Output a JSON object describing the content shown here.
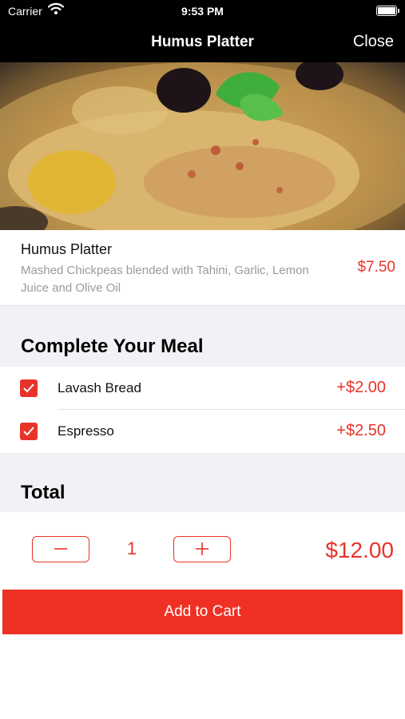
{
  "status_bar": {
    "carrier": "Carrier",
    "time": "9:53 PM"
  },
  "nav": {
    "title": "Humus Platter",
    "close_label": "Close"
  },
  "hero": {
    "image": "hummus-platter-photo"
  },
  "dish": {
    "name": "Humus Platter",
    "description": "Mashed Chickpeas blended with Tahini, Garlic, Lemon Juice and Olive Oil",
    "price": "$7.50"
  },
  "meal": {
    "heading": "Complete Your Meal",
    "addons": [
      {
        "label": "Lavash Bread",
        "price": "+$2.00",
        "checked": true
      },
      {
        "label": "Espresso",
        "price": "+$2.50",
        "checked": true
      }
    ]
  },
  "total": {
    "heading": "Total",
    "quantity": "1",
    "amount": "$12.00",
    "minus_icon": "minus-icon",
    "plus_icon": "plus-icon"
  },
  "cart": {
    "button_label": "Add to Cart"
  },
  "colors": {
    "accent": "#e8332a",
    "bar": "#000000",
    "section_bg": "#f2f2f6"
  }
}
